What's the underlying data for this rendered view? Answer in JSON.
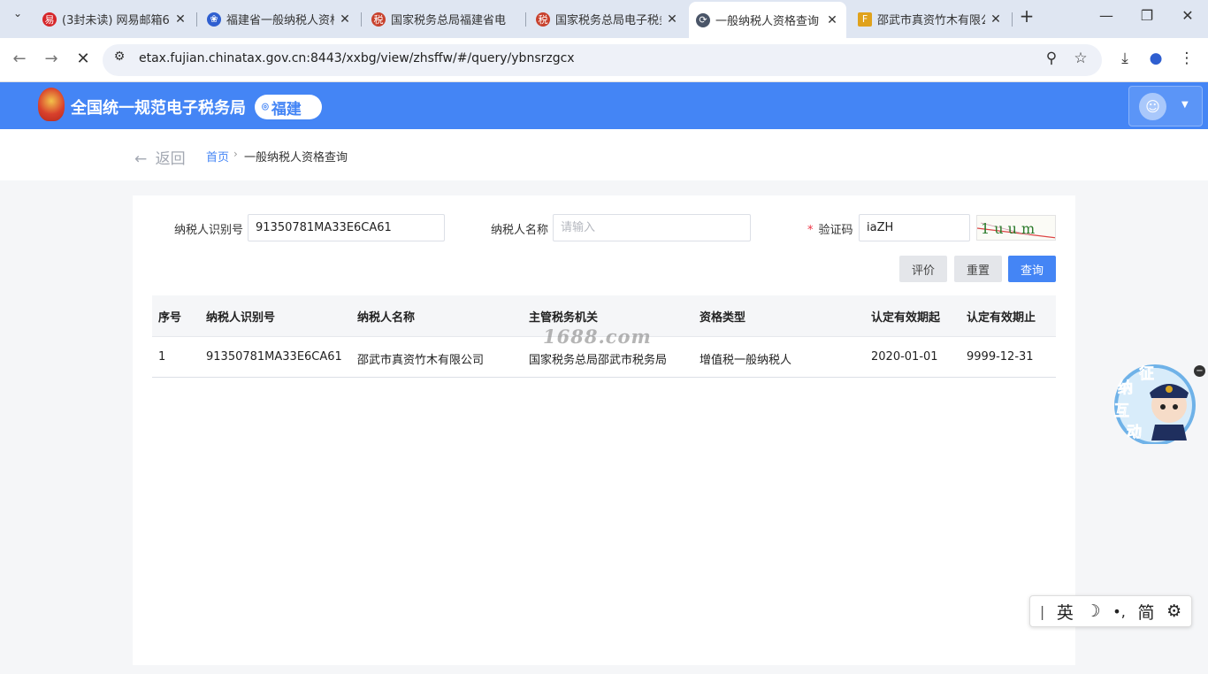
{
  "browser": {
    "tabs": [
      {
        "title": "(3封未读) 网易邮箱6.",
        "fav_color": "#d6262a",
        "fav_glyph": "易"
      },
      {
        "title": "福建省一般纳税人资格",
        "fav_color": "#2f5fd0",
        "fav_glyph": "❀"
      },
      {
        "title": "国家税务总局福建省电",
        "fav_color": "#c8412d",
        "fav_glyph": "税"
      },
      {
        "title": "国家税务总局电子税务",
        "fav_color": "#c8412d",
        "fav_glyph": "税"
      },
      {
        "title": "一般纳税人资格查询",
        "fav_color": "#4a5568",
        "fav_glyph": "⟳",
        "active": true
      },
      {
        "title": "邵武市真资竹木有限公",
        "fav_color": "#e0a21c",
        "fav_glyph": "F"
      }
    ],
    "url": "etax.fujian.chinatax.gov.cn:8443/xxbg/view/zhsffw/#/query/ybnsrzgcx"
  },
  "header": {
    "brand": "全国统一规范电子税务局",
    "region": "福建"
  },
  "breadcrumb": {
    "back_label": "返回",
    "home": "首页",
    "current": "一般纳税人资格查询"
  },
  "form": {
    "taxpayer_id_label": "纳税人识别号",
    "taxpayer_id_value": "91350781MA33E6CA61",
    "taxpayer_name_label": "纳税人名称",
    "taxpayer_name_placeholder": "请输入",
    "captcha_label": "验证码",
    "captcha_value": "iaZH",
    "captcha_image_text": "1 u u m"
  },
  "buttons": {
    "evaluate": "评价",
    "reset": "重置",
    "query": "查询"
  },
  "table": {
    "columns": [
      "序号",
      "纳税人识别号",
      "纳税人名称",
      "主管税务机关",
      "资格类型",
      "认定有效期起",
      "认定有效期止"
    ],
    "rows": [
      [
        "1",
        "91350781MA33E6CA61",
        "邵武市真资竹木有限公司",
        "国家税务总局邵武市税务局",
        "增值税一般纳税人",
        "2020-01-01",
        "9999-12-31"
      ]
    ]
  },
  "watermark": "1688.com",
  "assistant": {
    "chars": [
      "征",
      "纳",
      "互",
      "动"
    ]
  },
  "ime": {
    "items": [
      "|",
      "英",
      "☽",
      "•,",
      "简",
      "⚙"
    ]
  },
  "colors": {
    "brand_blue": "#4485f5",
    "required_red": "#e34"
  }
}
